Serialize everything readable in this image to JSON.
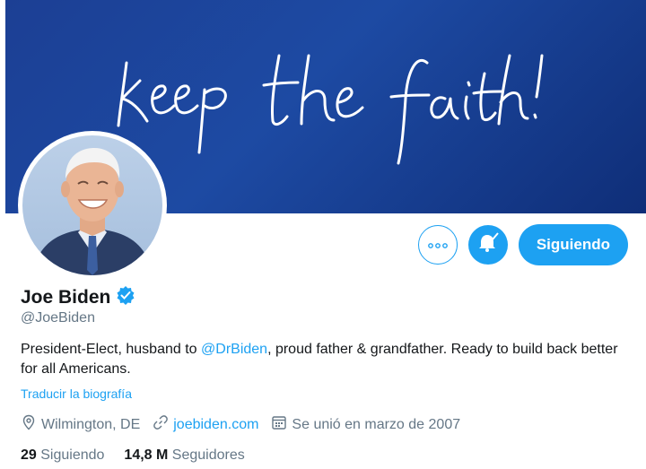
{
  "banner": {
    "handwriting": "keep the faith!"
  },
  "profile": {
    "name": "Joe Biden",
    "handle": "@JoeBiden",
    "bio_before": "President-Elect, husband to ",
    "bio_mention": "@DrBiden",
    "bio_after": ", proud father & grandfather. Ready to build back better for all Americans.",
    "translate_label": "Traducir la biografía",
    "location": "Wilmington, DE",
    "website": "joebiden.com",
    "joined": "Se unió en marzo de 2007"
  },
  "actions": {
    "follow_label": "Siguiendo"
  },
  "stats": {
    "following_count": "29",
    "following_label": "Siguiendo",
    "followers_count": "14,8 M",
    "followers_label": "Seguidores"
  },
  "colors": {
    "accent": "#1da1f2",
    "banner": "#1d4aa3",
    "secondary_text": "#657786"
  },
  "icons": [
    "more-icon",
    "notification-bell-icon",
    "verified-badge-icon",
    "location-pin-icon",
    "link-icon",
    "calendar-icon"
  ]
}
